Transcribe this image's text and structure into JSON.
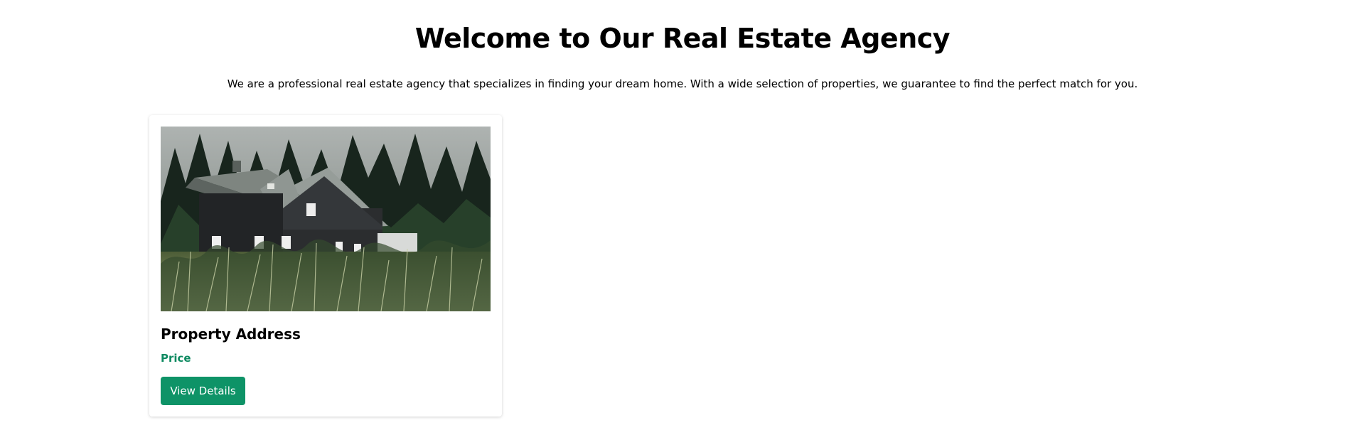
{
  "hero": {
    "title": "Welcome to Our Real Estate Agency",
    "description": "We are a professional real estate agency that specializes in finding your dream home. With a wide selection of properties, we guarantee to find the perfect match for you."
  },
  "listing": {
    "image_icon": "house-photo",
    "address_label": "Property Address",
    "price_label": "Price",
    "button_label": "View Details"
  },
  "colors": {
    "accent": "#0e9367",
    "price": "#0e8a61",
    "text": "#000000",
    "background": "#ffffff"
  }
}
